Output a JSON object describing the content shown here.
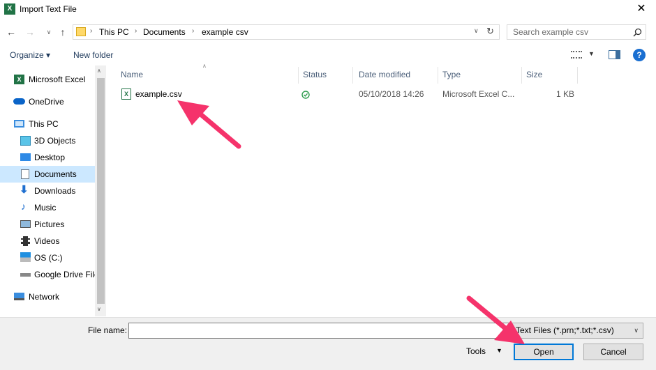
{
  "window": {
    "title": "Import Text File",
    "close_label": "✕"
  },
  "address": {
    "crumbs": [
      "This PC",
      "Documents",
      "example csv"
    ]
  },
  "search": {
    "placeholder": "Search example csv"
  },
  "toolbar": {
    "organize": "Organize ▾",
    "new_folder": "New folder"
  },
  "sidebar": {
    "items": [
      {
        "label": "Microsoft Excel",
        "icon": "excel-icon"
      },
      {
        "label": "OneDrive",
        "icon": "onedrive-icon"
      },
      {
        "label": "This PC",
        "icon": "pc-icon"
      },
      {
        "label": "3D Objects",
        "icon": "3d-objects-icon"
      },
      {
        "label": "Desktop",
        "icon": "desktop-icon"
      },
      {
        "label": "Documents",
        "icon": "documents-icon",
        "selected": true
      },
      {
        "label": "Downloads",
        "icon": "downloads-icon"
      },
      {
        "label": "Music",
        "icon": "music-icon"
      },
      {
        "label": "Pictures",
        "icon": "pictures-icon"
      },
      {
        "label": "Videos",
        "icon": "videos-icon"
      },
      {
        "label": "OS (C:)",
        "icon": "drive-icon"
      },
      {
        "label": "Google Drive File",
        "icon": "drive-icon"
      },
      {
        "label": "Network",
        "icon": "network-icon"
      }
    ]
  },
  "columns": {
    "name": "Name",
    "status": "Status",
    "date": "Date modified",
    "type": "Type",
    "size": "Size"
  },
  "files": [
    {
      "name": "example.csv",
      "date": "05/10/2018 14:26",
      "type": "Microsoft Excel C...",
      "size": "1 KB"
    }
  ],
  "bottom": {
    "file_name_label": "File name:",
    "file_name_value": "",
    "filter": "Text Files (*.prn;*.txt;*.csv)",
    "tools": "Tools",
    "open": "Open",
    "cancel": "Cancel"
  },
  "colors": {
    "accent": "#0078d7",
    "annotation": "#f5336b",
    "excel_green": "#217346"
  }
}
